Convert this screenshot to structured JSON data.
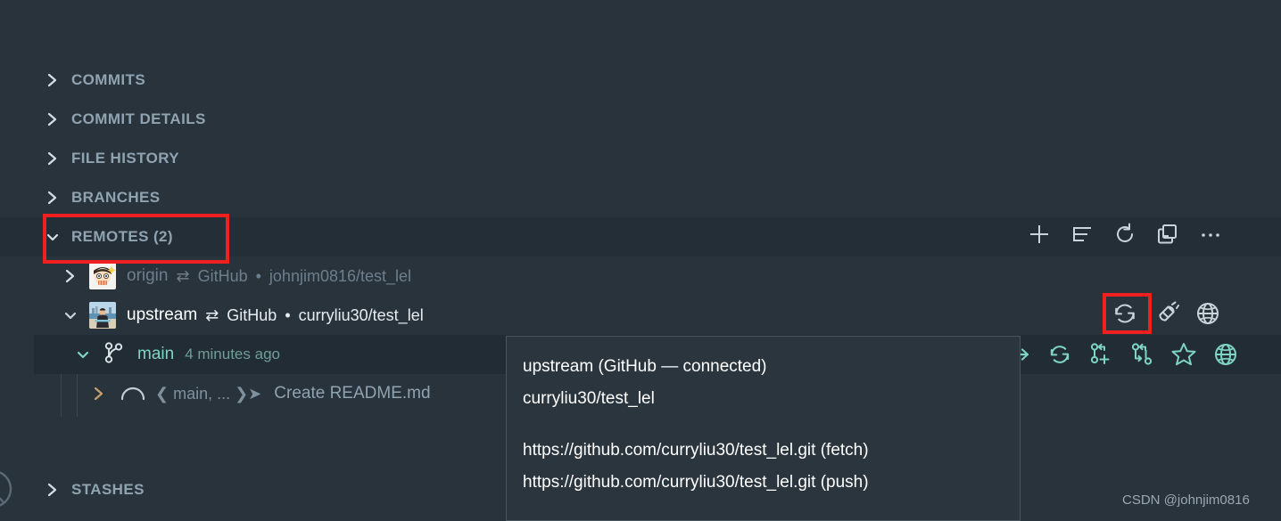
{
  "app": {
    "background": "#29333c",
    "accent_teal": "#7fd4c4",
    "annotation_color": "#f02020"
  },
  "sidebar": {
    "sections": [
      {
        "label": "COMMITS",
        "state": "collapsed",
        "icon": "chevron-right-icon"
      },
      {
        "label": "COMMIT DETAILS",
        "state": "collapsed",
        "icon": "chevron-right-icon"
      },
      {
        "label": "FILE HISTORY",
        "state": "collapsed",
        "icon": "chevron-right-icon"
      },
      {
        "label": "BRANCHES",
        "state": "collapsed",
        "icon": "chevron-right-icon"
      },
      {
        "label": "REMOTES (2)",
        "state": "expanded",
        "icon": "chevron-down-icon",
        "highlighted": true
      },
      {
        "label": "STASHES",
        "state": "collapsed",
        "icon": "chevron-right-icon"
      }
    ]
  },
  "remotes_header_actions": [
    {
      "name": "add-remote-button",
      "icon": "plus-icon",
      "label": "Add Remote"
    },
    {
      "name": "sort-remotes-button",
      "icon": "list-sort-icon",
      "label": "Sort"
    },
    {
      "name": "refresh-remotes-button",
      "icon": "refresh-icon",
      "label": "Refresh"
    },
    {
      "name": "collapse-all-button",
      "icon": "collapse-panes-icon",
      "label": "Collapse"
    },
    {
      "name": "more-actions-button",
      "icon": "ellipsis-icon",
      "label": "More Actions"
    }
  ],
  "remotes": [
    {
      "name": "origin",
      "arrows": "⇄",
      "host": "GitHub",
      "dot": "•",
      "repo": "johnjim0816/test_lel",
      "state": "collapsed",
      "expand_icon": "chevron-right-icon",
      "avatar": "avatar-origin",
      "muted": true
    },
    {
      "name": "upstream",
      "arrows": "⇄",
      "host": "GitHub",
      "dot": "•",
      "repo": "curryliu30/test_lel",
      "state": "expanded",
      "expand_icon": "chevron-down-icon",
      "avatar": "avatar-upstream",
      "muted": false
    }
  ],
  "upstream_row_actions": [
    {
      "name": "fetch-remote-button",
      "icon": "sync-icon",
      "label": "Fetch",
      "highlighted": true
    },
    {
      "name": "manage-connection-button",
      "icon": "plug-icon",
      "label": "Connection"
    },
    {
      "name": "open-on-remote-button",
      "icon": "globe-icon",
      "label": "Open on Remote"
    }
  ],
  "branch": {
    "expand_icon": "chevron-down-icon",
    "icon": "branch-icon",
    "name": "main",
    "timestamp": "4 minutes ago",
    "actions": [
      {
        "name": "arrow-right-indicator",
        "icon": "arrow-right-icon"
      },
      {
        "name": "fetch-branch-button",
        "icon": "sync-icon"
      },
      {
        "name": "create-branch-button",
        "icon": "branch-plus-icon"
      },
      {
        "name": "switch-branch-button",
        "icon": "branch-switch-icon"
      },
      {
        "name": "favorite-branch-button",
        "icon": "star-icon"
      },
      {
        "name": "open-branch-on-remote-button",
        "icon": "globe-icon"
      }
    ]
  },
  "commit": {
    "expand_icon": "chevron-right-icon",
    "graph_icon": "commit-arc-icon",
    "refs": "❮ main, ... ❯➤",
    "message": "Create README.md"
  },
  "tooltip": {
    "title": "upstream (GitHub — connected)",
    "repo": "curryliu30/test_lel",
    "fetch_url": "https://github.com/curryliu30/test_lel.git (fetch)",
    "push_url": "https://github.com/curryliu30/test_lel.git (push)"
  },
  "watermark": {
    "text": "CSDN @johnjim0816"
  }
}
